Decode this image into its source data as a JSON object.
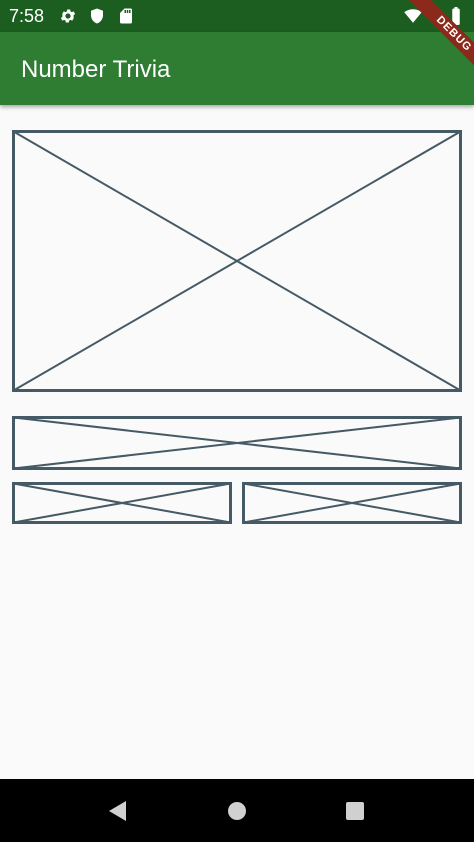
{
  "status_bar": {
    "time": "7:58",
    "left_icons": [
      "gear-icon",
      "shield-icon",
      "sd-card-icon"
    ],
    "right_icons": [
      "wifi-icon",
      "battery-icon"
    ]
  },
  "app_bar": {
    "title": "Number Trivia",
    "color": "#2e7d32"
  },
  "debug_banner": {
    "label": "DEBUG"
  },
  "colors": {
    "status_bar": "#1b5e20",
    "placeholder_stroke": "#455a64",
    "background": "#fafafa"
  },
  "nav_bar": {
    "buttons": [
      "back-icon",
      "home-icon",
      "recents-icon"
    ]
  }
}
